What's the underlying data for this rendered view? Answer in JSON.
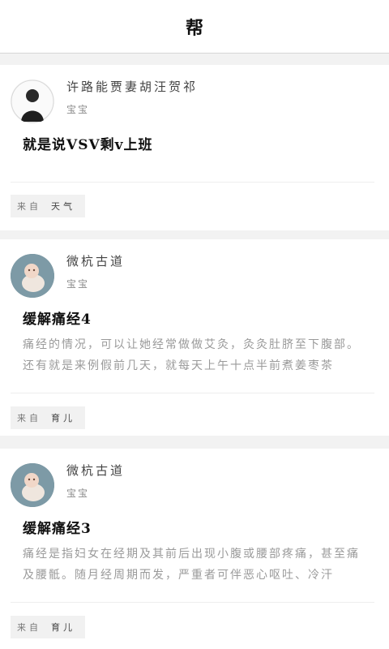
{
  "header": {
    "title": "帮"
  },
  "posts": [
    {
      "author": "许路能贾妻胡汪贺祁",
      "author_sub": "宝宝",
      "title": "就是说VSV剩v上班",
      "body": "",
      "source_prefix": "来自",
      "source_name": "天气",
      "avatar_icon": "dark-silhouette-avatar"
    },
    {
      "author": "微杭古道",
      "author_sub": "宝宝",
      "title": "缓解痛经4",
      "body": "痛经的情况，可以让她经常做做艾灸，灸灸肚脐至下腹部。还有就是来例假前几天，就每天上午十点半前煮姜枣茶",
      "source_prefix": "来自",
      "source_name": "育儿",
      "avatar_icon": "baby-photo-avatar"
    },
    {
      "author": "微杭古道",
      "author_sub": "宝宝",
      "title": "缓解痛经3",
      "body": "痛经是指妇女在经期及其前后出现小腹或腰部疼痛，甚至痛及腰骶。随月经周期而发，严重者可伴恶心呕吐、冷汗",
      "source_prefix": "来自",
      "source_name": "育儿",
      "avatar_icon": "baby-photo-avatar"
    }
  ]
}
